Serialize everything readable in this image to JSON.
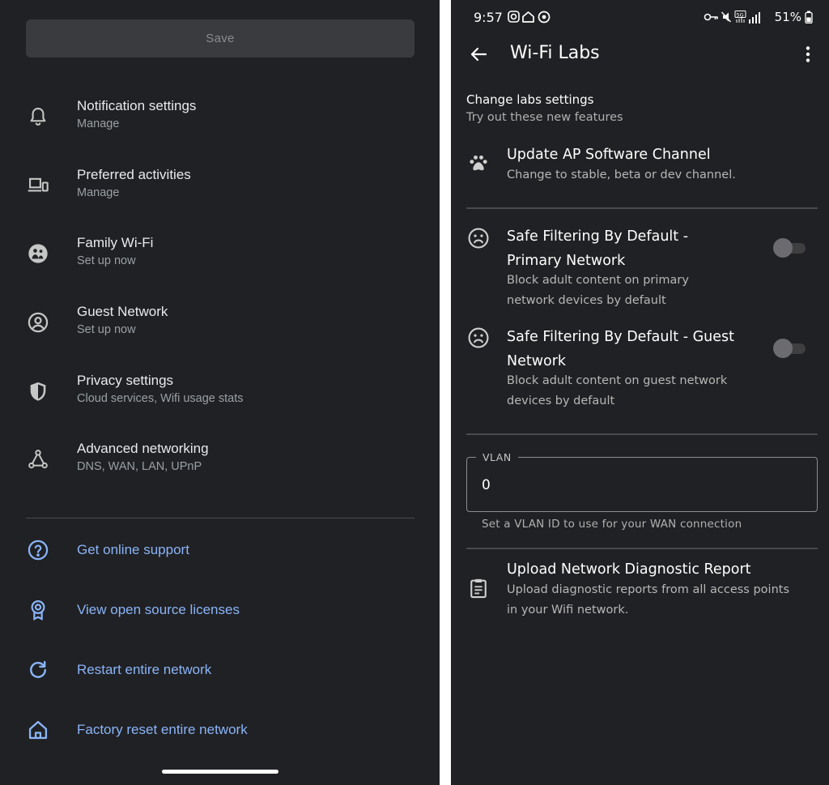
{
  "left": {
    "save_label": "Save",
    "items": [
      {
        "title": "Notification settings",
        "subtitle": "Manage",
        "icon": "bell-icon"
      },
      {
        "title": "Preferred activities",
        "subtitle": "Manage",
        "icon": "devices-icon"
      },
      {
        "title": "Family Wi-Fi",
        "subtitle": "Set up now",
        "icon": "family-icon"
      },
      {
        "title": "Guest Network",
        "subtitle": "Set up now",
        "icon": "guest-icon"
      },
      {
        "title": "Privacy settings",
        "subtitle": "Cloud services, Wifi usage stats",
        "icon": "shield-icon"
      },
      {
        "title": "Advanced networking",
        "subtitle": "DNS, WAN, LAN, UPnP",
        "icon": "network-icon"
      }
    ],
    "links": [
      {
        "label": "Get online support",
        "icon": "help-icon"
      },
      {
        "label": "View open source licenses",
        "icon": "license-icon"
      },
      {
        "label": "Restart entire network",
        "icon": "restart-icon"
      },
      {
        "label": "Factory reset entire network",
        "icon": "home-icon"
      }
    ],
    "link_color": "#8ab4f8"
  },
  "right": {
    "status": {
      "time": "9:57",
      "battery": "51%"
    },
    "title": "Wi-Fi Labs",
    "section_title": "Change labs settings",
    "section_subtitle": "Try out these new features",
    "labs": [
      {
        "title": "Update AP Software Channel",
        "subtitle": "Change to stable, beta or dev channel.",
        "icon": "paw-icon"
      },
      {
        "title_l1": "Safe Filtering By Default -",
        "title_l2": "Primary Network",
        "sub_l1": "Block adult content on primary",
        "sub_l2": "network devices by default",
        "icon": "sad-face-icon",
        "enabled": false
      },
      {
        "title_l1": "Safe Filtering By Default - Guest",
        "title_l2": "Network",
        "sub_l1": "Block adult content on guest network",
        "sub_l2": "devices by default",
        "icon": "sad-face-icon",
        "enabled": false
      }
    ],
    "vlan": {
      "label": "VLAN",
      "value": "0",
      "help": "Set a VLAN ID to use for your WAN connection"
    },
    "diagnostic": {
      "title": "Upload Network Diagnostic Report",
      "sub_l1": "Upload diagnostic reports from all access points",
      "sub_l2": "in your Wifi network.",
      "icon": "clipboard-icon"
    }
  }
}
